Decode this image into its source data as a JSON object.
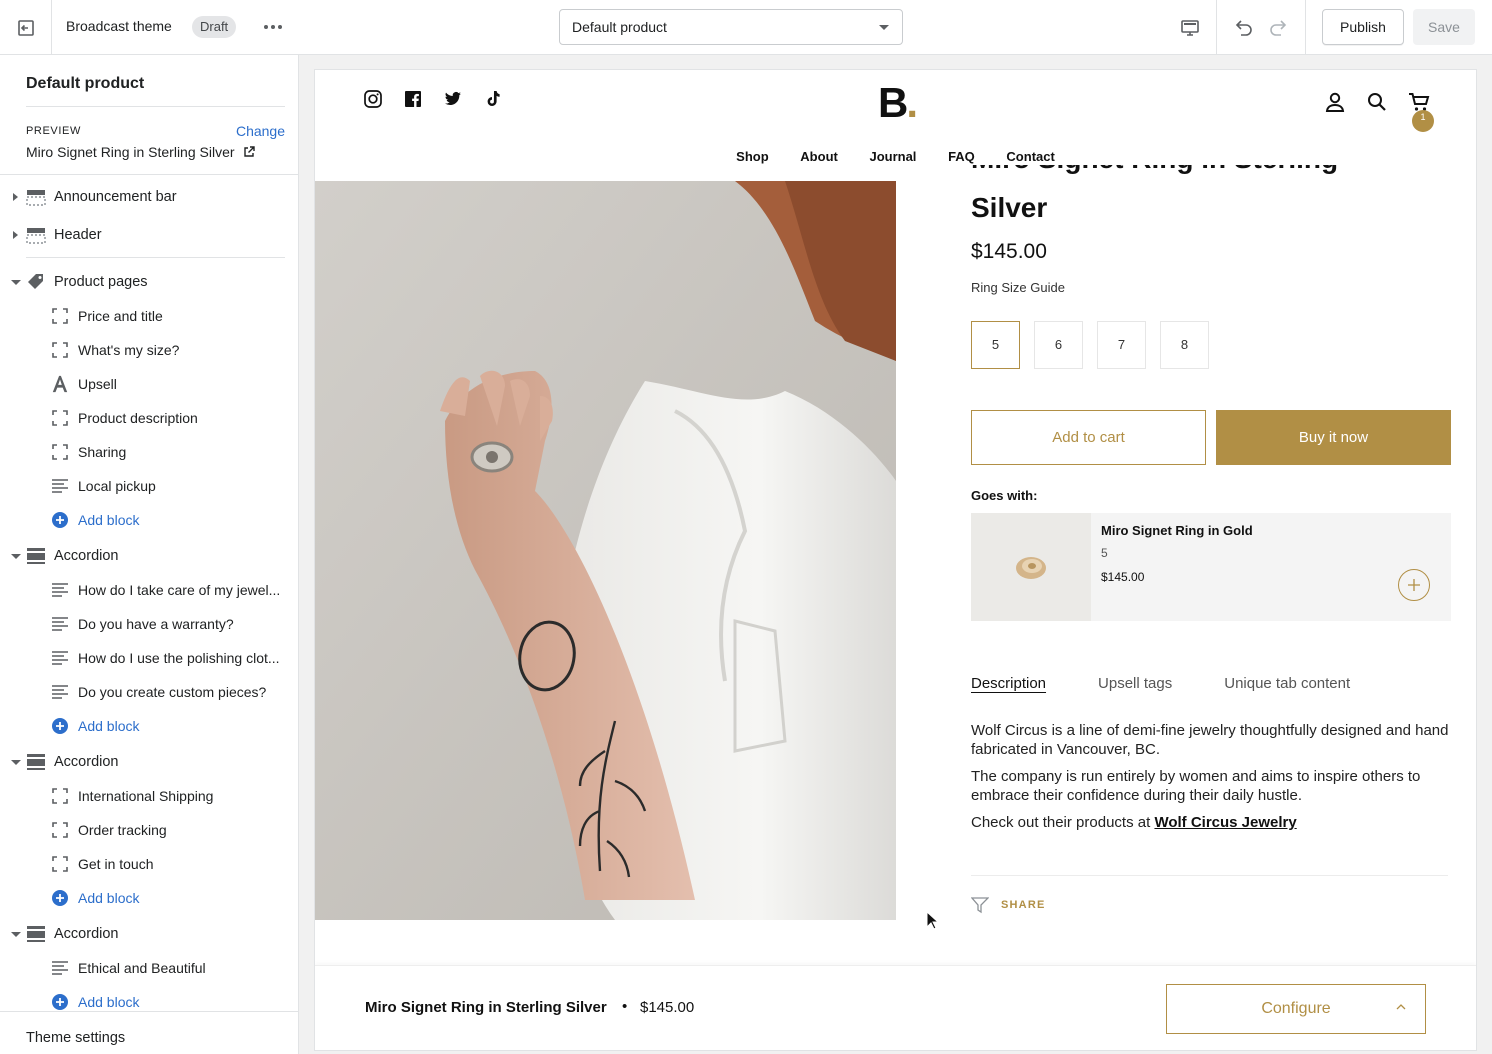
{
  "topbar": {
    "theme_name": "Broadcast theme",
    "status_badge": "Draft",
    "template_select": "Default product",
    "publish_label": "Publish",
    "save_label": "Save"
  },
  "sidebar": {
    "title": "Default product",
    "preview_label": "PREVIEW",
    "change_label": "Change",
    "preview_value": "Miro Signet Ring in Sterling Silver",
    "sections_top": [
      {
        "label": "Announcement bar",
        "icon": "layout-section-icon"
      },
      {
        "label": "Header",
        "icon": "layout-header-icon"
      }
    ],
    "product_pages": {
      "label": "Product pages",
      "icon": "tag-icon",
      "blocks": [
        {
          "label": "Price and title",
          "icon": "block-dashed-icon"
        },
        {
          "label": "What's my size?",
          "icon": "block-dashed-icon"
        },
        {
          "label": "Upsell",
          "icon": "text-a-icon"
        },
        {
          "label": "Product description",
          "icon": "block-dashed-icon"
        },
        {
          "label": "Sharing",
          "icon": "block-dashed-icon"
        },
        {
          "label": "Local pickup",
          "icon": "text-lines-icon"
        }
      ],
      "add_block": "Add block"
    },
    "accordion_1": {
      "label": "Accordion",
      "blocks": [
        "How do I take care of my jewel...",
        "Do you have a warranty?",
        "How do I use the polishing clot...",
        "Do you create custom pieces?"
      ],
      "add_block": "Add block"
    },
    "accordion_2": {
      "label": "Accordion",
      "blocks": [
        "International Shipping",
        "Order tracking",
        "Get in touch"
      ],
      "add_block": "Add block"
    },
    "accordion_3": {
      "label": "Accordion",
      "blocks": [
        "Ethical and Beautiful"
      ],
      "add_block": "Add block"
    },
    "theme_settings": "Theme settings"
  },
  "store": {
    "logo": "B",
    "logo_dot": ".",
    "cart_count": "1",
    "nav": [
      "Shop",
      "About",
      "Journal",
      "FAQ",
      "Contact"
    ],
    "product": {
      "title": "Miro Signet Ring in Sterling Silver",
      "title_line1": "Miro Signet Ring in Sterling",
      "title_line2": "Silver",
      "price": "$145.00",
      "size_guide": "Ring Size Guide",
      "sizes": [
        "5",
        "6",
        "7",
        "8"
      ],
      "selected_size": "5",
      "add_to_cart": "Add to cart",
      "buy_now": "Buy it now",
      "goes_with_label": "Goes with:",
      "upsell": {
        "name": "Miro Signet Ring in Gold",
        "variant": "5",
        "price": "$145.00"
      },
      "tabs": [
        "Description",
        "Upsell tags",
        "Unique tab content"
      ],
      "active_tab": "Description",
      "description": {
        "p1": "Wolf Circus is a line of demi-fine jewelry thoughtfully designed and hand fabricated in Vancouver, BC.",
        "p2": "The company is run entirely by women and aims to inspire others to embrace their confidence during their daily hustle.",
        "p3_prefix": "Check out their products at ",
        "p3_link": "Wolf Circus Jewelry"
      },
      "share_label": "SHARE"
    },
    "sticky_bar": {
      "name": "Miro Signet Ring in Sterling Silver",
      "bullet": "•",
      "price": "$145.00",
      "configure": "Configure"
    }
  },
  "colors": {
    "accent_gold": "#b18f45",
    "admin_link": "#2c6ecb"
  }
}
